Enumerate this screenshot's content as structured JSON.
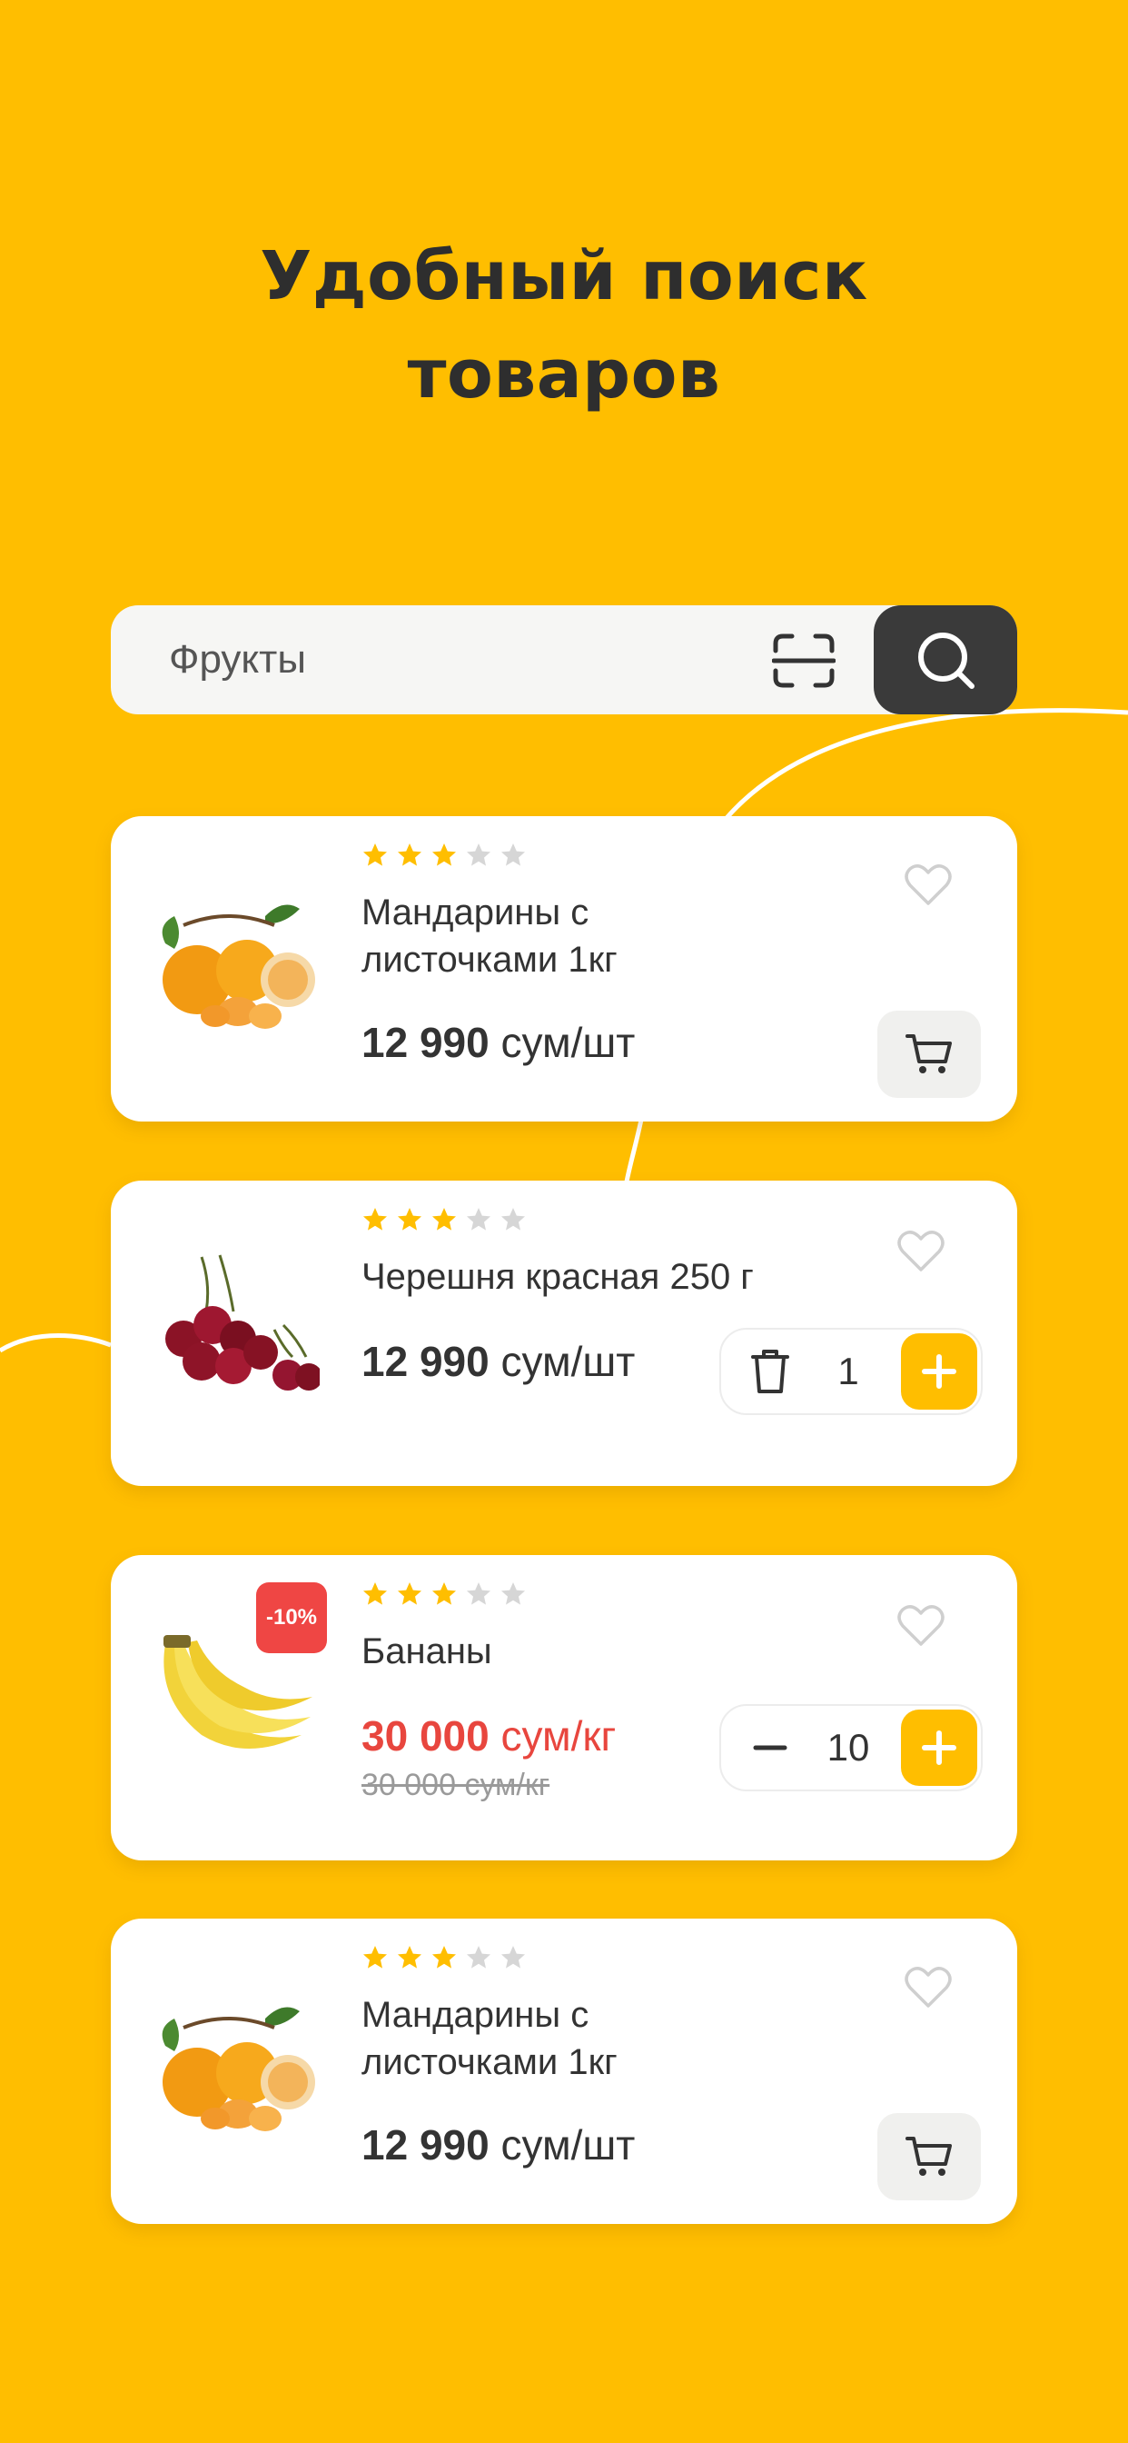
{
  "headline": {
    "line1": "Удобный поиск",
    "line2": "товаров"
  },
  "search": {
    "value": "Фрукты",
    "scan_icon": "scan-icon",
    "search_icon": "search-icon"
  },
  "colors": {
    "background": "#FFBE00",
    "card": "#FFFFFF",
    "accent": "#FFBE00",
    "dark": "#3A3A3A",
    "sale": "#E8463E",
    "star_active": "#FFBE00",
    "star_inactive": "#D6D6D6"
  },
  "products": [
    {
      "name": "Мандарины с листочками 1кг",
      "price_value": "12 990",
      "price_unit": "сум/шт",
      "rating": 3,
      "max_rating": 5,
      "action": "cart",
      "image": "tangerines"
    },
    {
      "name": "Черешня красная 250 г",
      "price_value": "12 990",
      "price_unit": "сум/шт",
      "rating": 3,
      "max_rating": 5,
      "action": "stepper",
      "quantity": "1",
      "image": "cherries"
    },
    {
      "name": "Бананы",
      "price_value": "30 000",
      "price_unit": "сум/кг",
      "old_price": "30 000 сум/кг",
      "discount_badge": "-10%",
      "rating": 3,
      "max_rating": 5,
      "action": "stepper",
      "quantity": "10",
      "image": "bananas"
    },
    {
      "name": "Мандарины с листочками 1кг",
      "price_value": "12 990",
      "price_unit": "сум/шт",
      "rating": 3,
      "max_rating": 5,
      "action": "cart",
      "image": "tangerines"
    }
  ]
}
